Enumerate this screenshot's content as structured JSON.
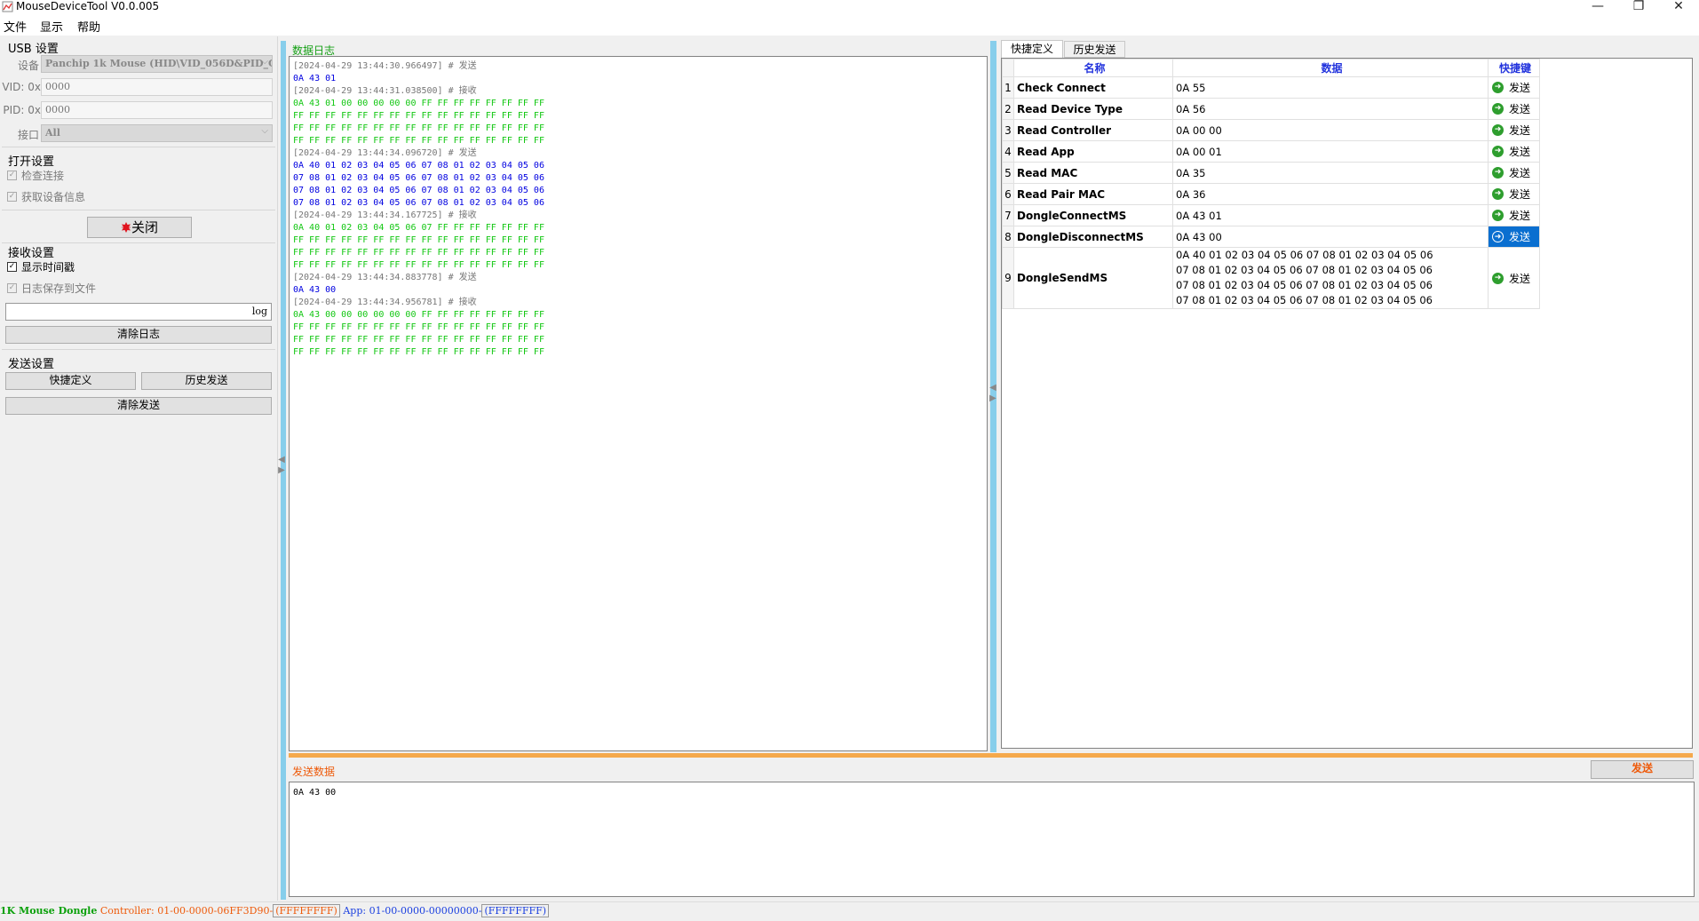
{
  "window": {
    "title": "MouseDeviceTool V0.0.005",
    "minimize_glyph": "—",
    "restore_glyph": "❐",
    "close_glyph": "✕"
  },
  "menu": [
    "文件",
    "显示",
    "帮助"
  ],
  "left": {
    "usb_group": "USB 设置",
    "device_label": "设备",
    "device_value": "Panchip 1k Mouse (HID\\VID_056D&PID_C",
    "vid_label": "VID: 0x",
    "vid_value": "0000",
    "pid_label": "PID: 0x",
    "pid_value": "0000",
    "port_label": "接口",
    "port_value": "All",
    "open_group": "打开设置",
    "check_connect": "检查连接",
    "get_device_info": "获取设备信息",
    "close_button": "关闭",
    "recv_group": "接收设置",
    "show_timestamp": "显示时间戳",
    "save_log": "日志保存到文件",
    "log_filename": "log",
    "clear_log_button": "清除日志",
    "send_group": "发送设置",
    "quick_define_button": "快捷定义",
    "history_send_button": "历史发送",
    "clear_send_button": "清除发送"
  },
  "log": {
    "title": "数据日志",
    "lines": [
      {
        "type": "time",
        "text": "[2024-04-29 13:44:30.966497] # 发送"
      },
      {
        "type": "send",
        "text": "0A 43 01"
      },
      {
        "type": "time",
        "text": "[2024-04-29 13:44:31.038500] # 接收"
      },
      {
        "type": "recv",
        "text": "0A 43 01 00 00 00 00 00 FF FF FF FF FF FF FF FF"
      },
      {
        "type": "recv",
        "text": "FF FF FF FF FF FF FF FF FF FF FF FF FF FF FF FF"
      },
      {
        "type": "recv",
        "text": "FF FF FF FF FF FF FF FF FF FF FF FF FF FF FF FF"
      },
      {
        "type": "recv",
        "text": "FF FF FF FF FF FF FF FF FF FF FF FF FF FF FF FF"
      },
      {
        "type": "time",
        "text": "[2024-04-29 13:44:34.096720] # 发送"
      },
      {
        "type": "send",
        "text": "0A 40 01 02 03 04 05 06 07 08 01 02 03 04 05 06"
      },
      {
        "type": "send",
        "text": "07 08 01 02 03 04 05 06 07 08 01 02 03 04 05 06"
      },
      {
        "type": "send",
        "text": "07 08 01 02 03 04 05 06 07 08 01 02 03 04 05 06"
      },
      {
        "type": "send",
        "text": "07 08 01 02 03 04 05 06 07 08 01 02 03 04 05 06"
      },
      {
        "type": "time",
        "text": "[2024-04-29 13:44:34.167725] # 接收"
      },
      {
        "type": "recv",
        "text": "0A 40 01 02 03 04 05 06 07 FF FF FF FF FF FF FF"
      },
      {
        "type": "recv",
        "text": "FF FF FF FF FF FF FF FF FF FF FF FF FF FF FF FF"
      },
      {
        "type": "recv",
        "text": "FF FF FF FF FF FF FF FF FF FF FF FF FF FF FF FF"
      },
      {
        "type": "recv",
        "text": "FF FF FF FF FF FF FF FF FF FF FF FF FF FF FF FF"
      },
      {
        "type": "time",
        "text": "[2024-04-29 13:44:34.883778] # 发送"
      },
      {
        "type": "send",
        "text": "0A 43 00"
      },
      {
        "type": "time",
        "text": "[2024-04-29 13:44:34.956781] # 接收"
      },
      {
        "type": "recv",
        "text": "0A 43 00 00 00 00 00 00 FF FF FF FF FF FF FF FF"
      },
      {
        "type": "recv",
        "text": "FF FF FF FF FF FF FF FF FF FF FF FF FF FF FF FF"
      },
      {
        "type": "recv",
        "text": "FF FF FF FF FF FF FF FF FF FF FF FF FF FF FF FF"
      },
      {
        "type": "recv",
        "text": "FF FF FF FF FF FF FF FF FF FF FF FF FF FF FF FF"
      }
    ]
  },
  "tabs": [
    "快捷定义",
    "历史发送"
  ],
  "quick": {
    "headers": {
      "name": "名称",
      "data": "数据",
      "shortcut": "快捷键"
    },
    "send_label": "发送",
    "rows": [
      {
        "num": "1",
        "name": "Check Connect",
        "data": [
          "0A 55"
        ],
        "selected": false
      },
      {
        "num": "2",
        "name": "Read Device Type",
        "data": [
          "0A 56"
        ],
        "selected": false
      },
      {
        "num": "3",
        "name": "Read Controller",
        "data": [
          "0A 00 00"
        ],
        "selected": false
      },
      {
        "num": "4",
        "name": "Read App",
        "data": [
          "0A 00 01"
        ],
        "selected": false
      },
      {
        "num": "5",
        "name": "Read MAC",
        "data": [
          "0A 35"
        ],
        "selected": false
      },
      {
        "num": "6",
        "name": "Read Pair MAC",
        "data": [
          "0A 36"
        ],
        "selected": false
      },
      {
        "num": "7",
        "name": "DongleConnectMS",
        "data": [
          "0A 43 01"
        ],
        "selected": false
      },
      {
        "num": "8",
        "name": "DongleDisconnectMS",
        "data": [
          "0A 43 00"
        ],
        "selected": true
      },
      {
        "num": "9",
        "name": "DongleSendMS",
        "data": [
          "0A 40 01 02 03 04 05 06 07 08 01 02 03 04 05 06",
          "07 08 01 02 03 04 05 06 07 08 01 02 03 04 05 06",
          "07 08 01 02 03 04 05 06 07 08 01 02 03 04 05 06",
          "07 08 01 02 03 04 05 06 07 08 01 02 03 04 05 06"
        ],
        "selected": false
      }
    ]
  },
  "send": {
    "title": "发送数据",
    "button": "发送",
    "content": "0A 43 00"
  },
  "status": {
    "device": "1K Mouse Dongle",
    "controller": "Controller: 01-00-0000-06FF3D90-",
    "controller_box": "(FFFFFFFF)",
    "app": "App: 01-00-0000-00000000-",
    "app_box": "(FFFFFFFF)"
  }
}
